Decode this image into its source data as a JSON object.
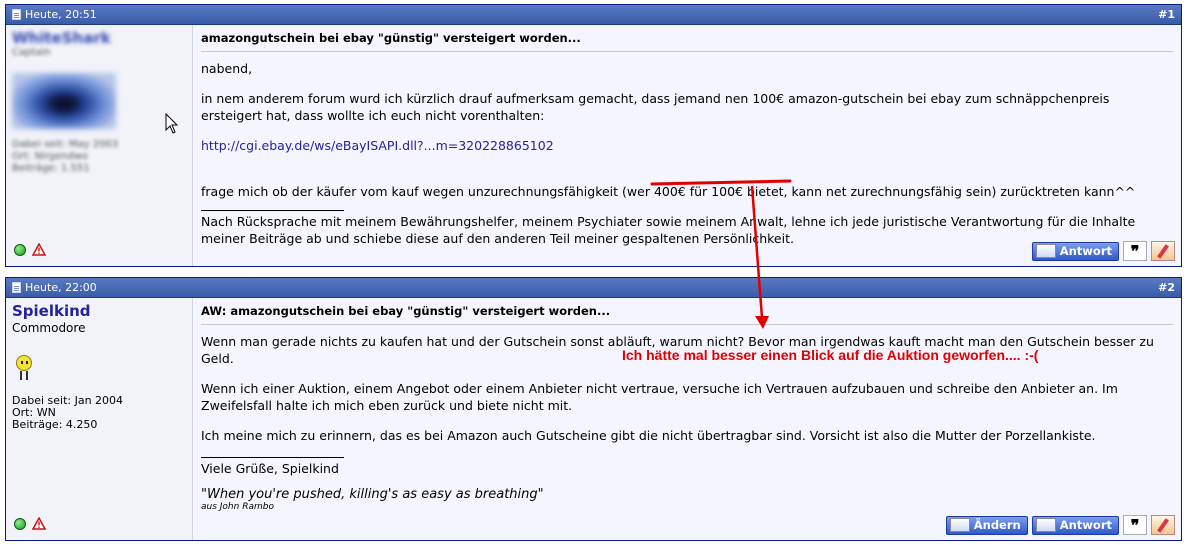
{
  "posts": [
    {
      "date": "Heute, 20:51",
      "number": "#1",
      "user": {
        "name": "WhiteShark",
        "rank": "Captain",
        "info_lines": [
          "Dabei seit: May 2003",
          "Ort: Nirgendwo",
          "Beiträge: 1.551"
        ]
      },
      "title": "amazongutschein bei ebay \"günstig\" versteigert worden...",
      "paragraphs": [
        "nabend,",
        "in nem anderem forum wurd ich kürzlich drauf aufmerksam gemacht, dass jemand nen 100€ amazon-gutschein bei ebay zum schnäppchenpreis ersteigert hat, dass wollte ich euch nicht vorenthalten:"
      ],
      "link": "http://cgi.ebay.de/ws/eBayISAPI.dll?...m=320228865102",
      "last_para_before": "frage mich ob der käufer vom kauf wegen unzurechnungsfähigkeit (wer ",
      "last_para_highlight": "400€ für 100€ bietet",
      "last_para_after": ", kann net zurechnungsfähig sein) zurücktreten kann^^",
      "signature": "Nach Rücksprache mit meinem Bewährungshelfer, meinem Psychiater sowie meinem Anwalt, lehne ich jede juristische Verantwortung für die Inhalte meiner Beiträge ab und schiebe diese auf den anderen Teil meiner gespaltenen Persönlichkeit.",
      "buttons": {
        "reply": "Antwort"
      }
    },
    {
      "date": "Heute, 22:00",
      "number": "#2",
      "user": {
        "name": "Spielkind",
        "rank": "Commodore",
        "joined": "Dabei seit: Jan 2004",
        "location": "Ort: WN",
        "posts": "Beiträge: 4.250"
      },
      "title": "AW: amazongutschein bei ebay \"günstig\" versteigert worden...",
      "paragraphs": [
        "Wenn man gerade nichts zu kaufen hat und der Gutschein sonst abläuft, warum nicht? Bevor man irgendwas kauft macht man den Gutschein besser zu Geld.",
        "Wenn ich einer Auktion, einem Angebot oder einem Anbieter nicht vertraue, versuche ich Vertrauen aufzubauen und schreibe den Anbieter an. Im Zweifelsfall halte ich mich eben zurück und biete nicht mit.",
        "Ich meine mich zu erinnern, das es bei Amazon auch Gutscheine gibt die nicht übertragbar sind. Vorsicht ist also die Mutter der Porzellankiste."
      ],
      "signature_greeting": "Viele Grüße, Spielkind",
      "quote": "\"When you're pushed, killing's as easy as breathing\"",
      "quote_author": "aus John Rambo",
      "buttons": {
        "edit": "Ändern",
        "reply": "Antwort"
      }
    }
  ],
  "annotation": "Ich hätte mal besser einen Blick auf die Auktion geworfen.... :-(",
  "colors": {
    "header": "#3a5ca8",
    "link": "#22229c",
    "annotation": "#e00000"
  }
}
